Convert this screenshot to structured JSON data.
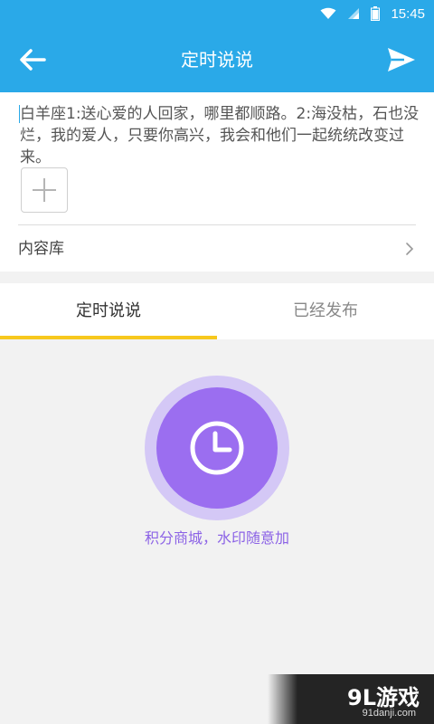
{
  "status_bar": {
    "time": "15:45"
  },
  "app_bar": {
    "title": "定时说说",
    "back_icon": "arrow-left-icon",
    "send_icon": "send-icon"
  },
  "compose": {
    "text": "白羊座1:送心爱的人回家，哪里都顺路。2:海没枯，石也没烂，我的爱人，只要你高兴，我会和他们一起统统改变过来。",
    "add_image_icon": "plus-icon",
    "library_label": "内容库"
  },
  "tabs": [
    {
      "label": "定时说说",
      "active": true
    },
    {
      "label": "已经发布",
      "active": false
    }
  ],
  "timer": {
    "icon": "clock-icon",
    "promo_text": "积分商城，水印随意加"
  },
  "watermark": {
    "brand": "9L游戏",
    "site": "91danji.com"
  },
  "colors": {
    "primary": "#2aa9e8",
    "accent_purple": "#9b6ef0",
    "tab_indicator": "#f7c81d"
  }
}
